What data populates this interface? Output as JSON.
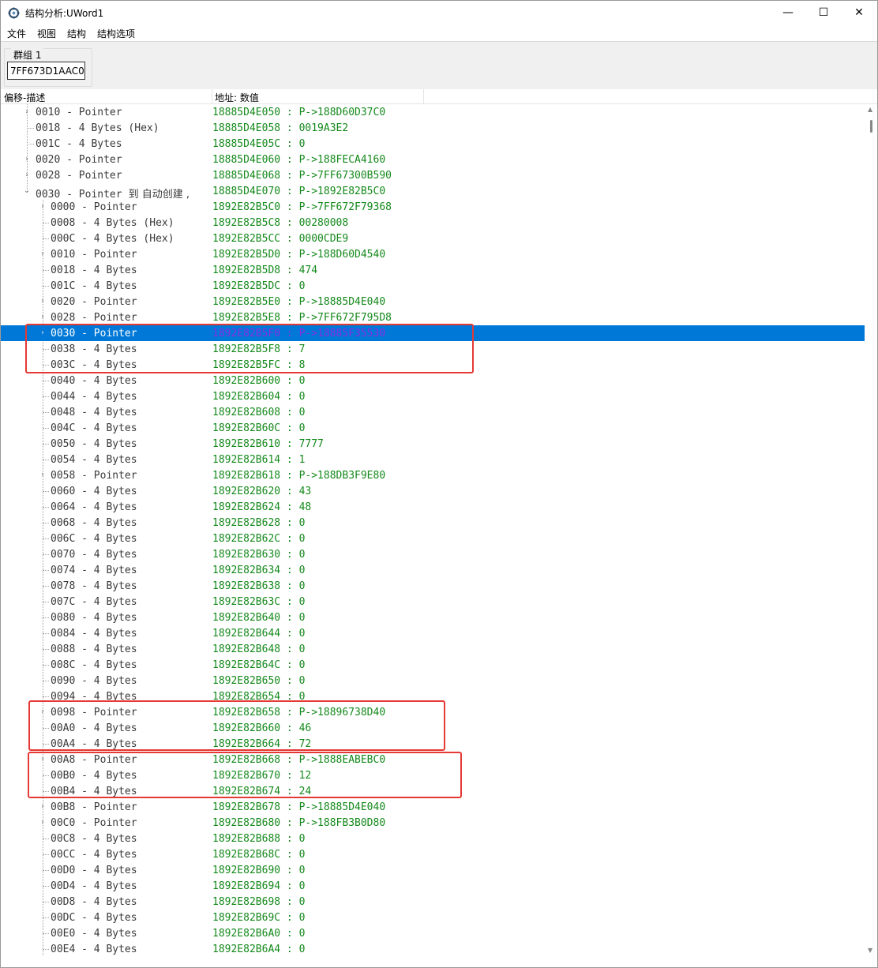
{
  "window": {
    "title": "结构分析:UWord1",
    "minimize_glyph": "—",
    "maximize_glyph": "☐",
    "close_glyph": "✕"
  },
  "menu": {
    "items": [
      "文件",
      "视图",
      "结构",
      "结构选项"
    ]
  },
  "group": {
    "label": "群组 1",
    "address": "7FF673D1AAC0"
  },
  "columns": {
    "offset_desc": "偏移-描述",
    "address_value": "地址: 数值"
  },
  "colors": {
    "selection": "#0078d7",
    "value_text": "#14891b",
    "highlight_box": "#e53935"
  },
  "rows": [
    {
      "level": 1,
      "exp": "collapsed",
      "o": "0010",
      "t": "Pointer",
      "a": "18885D4E050",
      "v": "P->188D60D37C0"
    },
    {
      "level": 1,
      "o": "0018",
      "t": "4 Bytes (Hex)",
      "a": "18885D4E058",
      "v": "0019A3E2"
    },
    {
      "level": 1,
      "o": "001C",
      "t": "4 Bytes",
      "a": "18885D4E05C",
      "v": "0"
    },
    {
      "level": 1,
      "exp": "collapsed",
      "o": "0020",
      "t": "Pointer",
      "a": "18885D4E060",
      "v": "P->188FECA4160"
    },
    {
      "level": 1,
      "exp": "collapsed",
      "o": "0028",
      "t": "Pointer",
      "a": "18885D4E068",
      "v": "P->7FF67300B590"
    },
    {
      "level": 1,
      "exp": "expanded",
      "o": "0030",
      "t": "Pointer",
      "suffix": "到 自动创建 ,",
      "a": "18885D4E070",
      "v": "P->1892E82B5C0"
    },
    {
      "level": 2,
      "exp": "collapsed",
      "o": "0000",
      "t": "Pointer",
      "a": "1892E82B5C0",
      "v": "P->7FF672F79368"
    },
    {
      "level": 2,
      "o": "0008",
      "t": "4 Bytes (Hex)",
      "a": "1892E82B5C8",
      "v": "00280008"
    },
    {
      "level": 2,
      "o": "000C",
      "t": "4 Bytes (Hex)",
      "a": "1892E82B5CC",
      "v": "0000CDE9"
    },
    {
      "level": 2,
      "exp": "collapsed",
      "o": "0010",
      "t": "Pointer",
      "a": "1892E82B5D0",
      "v": "P->188D60D4540"
    },
    {
      "level": 2,
      "o": "0018",
      "t": "4 Bytes",
      "a": "1892E82B5D8",
      "v": "474"
    },
    {
      "level": 2,
      "o": "001C",
      "t": "4 Bytes",
      "a": "1892E82B5DC",
      "v": "0"
    },
    {
      "level": 2,
      "exp": "collapsed",
      "o": "0020",
      "t": "Pointer",
      "a": "1892E82B5E0",
      "v": "P->18885D4E040"
    },
    {
      "level": 2,
      "exp": "collapsed",
      "o": "0028",
      "t": "Pointer",
      "a": "1892E82B5E8",
      "v": "P->7FF672F795D8"
    },
    {
      "level": 2,
      "exp": "collapsed",
      "sel": true,
      "o": "0030",
      "t": "Pointer",
      "a": "1892E82B5F0",
      "v": "P->18885F35530"
    },
    {
      "level": 2,
      "o": "0038",
      "t": "4 Bytes",
      "a": "1892E82B5F8",
      "v": "7"
    },
    {
      "level": 2,
      "o": "003C",
      "t": "4 Bytes",
      "a": "1892E82B5FC",
      "v": "8"
    },
    {
      "level": 2,
      "o": "0040",
      "t": "4 Bytes",
      "a": "1892E82B600",
      "v": "0"
    },
    {
      "level": 2,
      "o": "0044",
      "t": "4 Bytes",
      "a": "1892E82B604",
      "v": "0"
    },
    {
      "level": 2,
      "o": "0048",
      "t": "4 Bytes",
      "a": "1892E82B608",
      "v": "0"
    },
    {
      "level": 2,
      "o": "004C",
      "t": "4 Bytes",
      "a": "1892E82B60C",
      "v": "0"
    },
    {
      "level": 2,
      "o": "0050",
      "t": "4 Bytes",
      "a": "1892E82B610",
      "v": "7777"
    },
    {
      "level": 2,
      "o": "0054",
      "t": "4 Bytes",
      "a": "1892E82B614",
      "v": "1"
    },
    {
      "level": 2,
      "exp": "collapsed",
      "o": "0058",
      "t": "Pointer",
      "a": "1892E82B618",
      "v": "P->188DB3F9E80"
    },
    {
      "level": 2,
      "o": "0060",
      "t": "4 Bytes",
      "a": "1892E82B620",
      "v": "43"
    },
    {
      "level": 2,
      "o": "0064",
      "t": "4 Bytes",
      "a": "1892E82B624",
      "v": "48"
    },
    {
      "level": 2,
      "o": "0068",
      "t": "4 Bytes",
      "a": "1892E82B628",
      "v": "0"
    },
    {
      "level": 2,
      "o": "006C",
      "t": "4 Bytes",
      "a": "1892E82B62C",
      "v": "0"
    },
    {
      "level": 2,
      "o": "0070",
      "t": "4 Bytes",
      "a": "1892E82B630",
      "v": "0"
    },
    {
      "level": 2,
      "o": "0074",
      "t": "4 Bytes",
      "a": "1892E82B634",
      "v": "0"
    },
    {
      "level": 2,
      "o": "0078",
      "t": "4 Bytes",
      "a": "1892E82B638",
      "v": "0"
    },
    {
      "level": 2,
      "o": "007C",
      "t": "4 Bytes",
      "a": "1892E82B63C",
      "v": "0"
    },
    {
      "level": 2,
      "o": "0080",
      "t": "4 Bytes",
      "a": "1892E82B640",
      "v": "0"
    },
    {
      "level": 2,
      "o": "0084",
      "t": "4 Bytes",
      "a": "1892E82B644",
      "v": "0"
    },
    {
      "level": 2,
      "o": "0088",
      "t": "4 Bytes",
      "a": "1892E82B648",
      "v": "0"
    },
    {
      "level": 2,
      "o": "008C",
      "t": "4 Bytes",
      "a": "1892E82B64C",
      "v": "0"
    },
    {
      "level": 2,
      "o": "0090",
      "t": "4 Bytes",
      "a": "1892E82B650",
      "v": "0"
    },
    {
      "level": 2,
      "o": "0094",
      "t": "4 Bytes",
      "a": "1892E82B654",
      "v": "0"
    },
    {
      "level": 2,
      "exp": "collapsed",
      "o": "0098",
      "t": "Pointer",
      "a": "1892E82B658",
      "v": "P->18896738D40"
    },
    {
      "level": 2,
      "o": "00A0",
      "t": "4 Bytes",
      "a": "1892E82B660",
      "v": "46"
    },
    {
      "level": 2,
      "o": "00A4",
      "t": "4 Bytes",
      "a": "1892E82B664",
      "v": "72"
    },
    {
      "level": 2,
      "exp": "collapsed",
      "o": "00A8",
      "t": "Pointer",
      "a": "1892E82B668",
      "v": "P->1888EABEBC0"
    },
    {
      "level": 2,
      "o": "00B0",
      "t": "4 Bytes",
      "a": "1892E82B670",
      "v": "12"
    },
    {
      "level": 2,
      "o": "00B4",
      "t": "4 Bytes",
      "a": "1892E82B674",
      "v": "24"
    },
    {
      "level": 2,
      "exp": "collapsed",
      "o": "00B8",
      "t": "Pointer",
      "a": "1892E82B678",
      "v": "P->18885D4E040"
    },
    {
      "level": 2,
      "exp": "collapsed",
      "o": "00C0",
      "t": "Pointer",
      "a": "1892E82B680",
      "v": "P->188FB3B0D80"
    },
    {
      "level": 2,
      "o": "00C8",
      "t": "4 Bytes",
      "a": "1892E82B688",
      "v": "0"
    },
    {
      "level": 2,
      "o": "00CC",
      "t": "4 Bytes",
      "a": "1892E82B68C",
      "v": "0"
    },
    {
      "level": 2,
      "o": "00D0",
      "t": "4 Bytes",
      "a": "1892E82B690",
      "v": "0"
    },
    {
      "level": 2,
      "o": "00D4",
      "t": "4 Bytes",
      "a": "1892E82B694",
      "v": "0"
    },
    {
      "level": 2,
      "o": "00D8",
      "t": "4 Bytes",
      "a": "1892E82B698",
      "v": "0"
    },
    {
      "level": 2,
      "o": "00DC",
      "t": "4 Bytes",
      "a": "1892E82B69C",
      "v": "0"
    },
    {
      "level": 2,
      "o": "00E0",
      "t": "4 Bytes",
      "a": "1892E82B6A0",
      "v": "0"
    },
    {
      "level": 2,
      "o": "00E4",
      "t": "4 Bytes",
      "a": "1892E82B6A4",
      "v": "0"
    }
  ]
}
